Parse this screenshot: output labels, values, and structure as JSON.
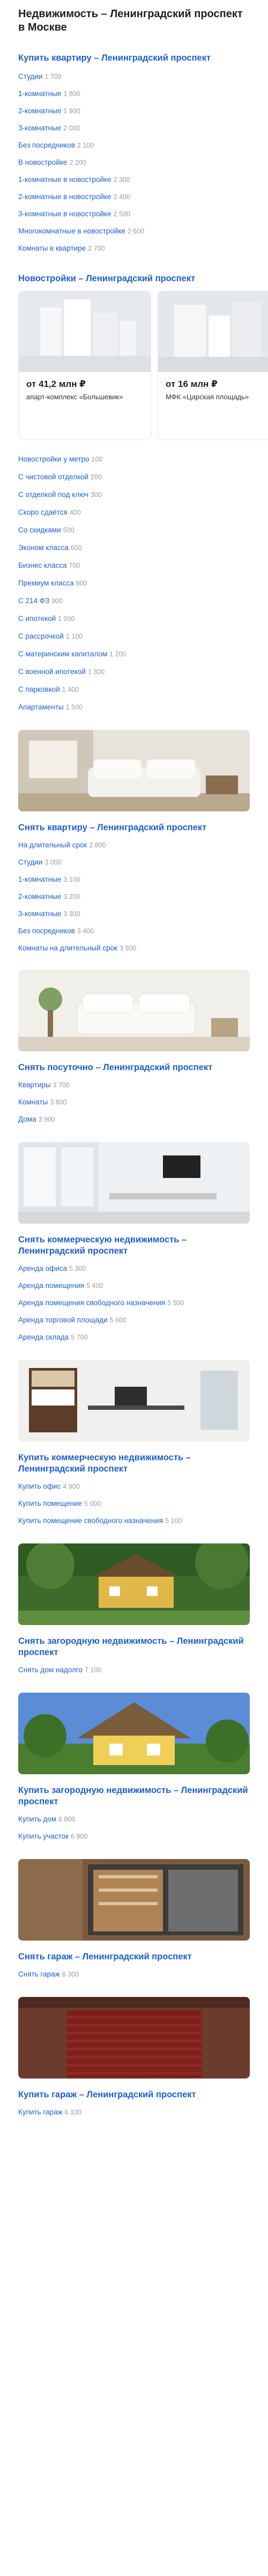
{
  "page": {
    "title": "Недвижимость – Ленинградский проспект в Москве"
  },
  "sections": {
    "buy_flat": {
      "title": "Купить квартиру – Ленинградский проспект",
      "links": [
        {
          "label": "Студии",
          "count": "1 700"
        },
        {
          "label": "1-комнатные",
          "count": "1 800"
        },
        {
          "label": "2-комнатные",
          "count": "1 900"
        },
        {
          "label": "3-комнатные",
          "count": "2 000"
        },
        {
          "label": "Без посредников",
          "count": "2 100"
        },
        {
          "label": "В новостройке",
          "count": "2 200"
        },
        {
          "label": "1-комнатные в новостройке",
          "count": "2 300"
        },
        {
          "label": "2-комнатные в новостройке",
          "count": "2 400"
        },
        {
          "label": "3-комнатные в новостройке",
          "count": "2 500"
        },
        {
          "label": "Многокомнатные в новостройке",
          "count": "2 600"
        },
        {
          "label": "Комнаты в квартире",
          "count": "2 700"
        }
      ]
    },
    "newbuildings": {
      "title": "Новостройки – Ленинградский проспект",
      "cards": [
        {
          "price": "от 41,2 млн ₽",
          "name": "апарт-комплекс «Большевик»"
        },
        {
          "price": "от 16 млн ₽",
          "name": "МФК «Царская площадь»"
        }
      ],
      "links": [
        {
          "label": "Новостройки у метро",
          "count": "100"
        },
        {
          "label": "С чистовой отделкой",
          "count": "200"
        },
        {
          "label": "С отделкой под ключ",
          "count": "300"
        },
        {
          "label": "Скоро сдаётся",
          "count": "400"
        },
        {
          "label": "Со скидками",
          "count": "500"
        },
        {
          "label": "Эконом класса",
          "count": "600"
        },
        {
          "label": "Бизнес класса",
          "count": "700"
        },
        {
          "label": "Премиум класса",
          "count": "800"
        },
        {
          "label": "С 214 ФЗ",
          "count": "900"
        },
        {
          "label": "С ипотекой",
          "count": "1 000"
        },
        {
          "label": "С рассрочкой",
          "count": "1 100"
        },
        {
          "label": "С материнским капиталом",
          "count": "1 200"
        },
        {
          "label": "С военной ипотекой",
          "count": "1 300"
        },
        {
          "label": "С парковкой",
          "count": "1 400"
        },
        {
          "label": "Апартаменты",
          "count": "1 500"
        }
      ]
    },
    "rent_flat": {
      "title": "Снять квартиру – Ленинградский проспект",
      "links": [
        {
          "label": "На длительный срок",
          "count": "2 800"
        },
        {
          "label": "Студии",
          "count": "3 000"
        },
        {
          "label": "1-комнатные",
          "count": "3 100"
        },
        {
          "label": "2-комнатные",
          "count": "3 200"
        },
        {
          "label": "3-комнатные",
          "count": "3 300"
        },
        {
          "label": "Без посредников",
          "count": "3 400"
        },
        {
          "label": "Комнаты на длительный срок",
          "count": "3 500"
        }
      ]
    },
    "daily": {
      "title": "Снять посуточно – Ленинградский проспект",
      "links": [
        {
          "label": "Квартиры",
          "count": "3 700"
        },
        {
          "label": "Комнаты",
          "count": "3 800"
        },
        {
          "label": "Дома",
          "count": "3 900"
        }
      ]
    },
    "rent_commercial": {
      "title": "Снять коммерческую недвижимость – Ленинградский проспект",
      "links": [
        {
          "label": "Аренда офиса",
          "count": "5 300"
        },
        {
          "label": "Аренда помещения",
          "count": "5 400"
        },
        {
          "label": "Аренда помещения свободного назначения",
          "count": "5 500"
        },
        {
          "label": "Аренда торговой площади",
          "count": "5 600"
        },
        {
          "label": "Аренда склада",
          "count": "5 700"
        }
      ]
    },
    "buy_commercial": {
      "title": "Купить коммерческую недвижимость – Ленинградский проспект",
      "links": [
        {
          "label": "Купить офис",
          "count": "4 900"
        },
        {
          "label": "Купить помещение",
          "count": "5 000"
        },
        {
          "label": "Купить помещение свободного назначения",
          "count": "5 100"
        }
      ]
    },
    "rent_country": {
      "title": "Снять загородную недвижимость – Ленинградский проспект",
      "links": [
        {
          "label": "Снять дом надолго",
          "count": "7 100"
        }
      ]
    },
    "buy_country": {
      "title": "Купить загородную недвижимость – Ленинградский проспект",
      "links": [
        {
          "label": "Купить дом",
          "count": "6 800"
        },
        {
          "label": "Купить участок",
          "count": "6 900"
        }
      ]
    },
    "rent_garage": {
      "title": "Снять гараж – Ленинградский проспект",
      "links": [
        {
          "label": "Снять гараж",
          "count": "6 300"
        }
      ]
    },
    "buy_garage": {
      "title": "Купить гараж – Ленинградский проспект",
      "links": [
        {
          "label": "Купить гараж",
          "count": "6 100"
        }
      ]
    }
  },
  "colors": {
    "link": "#1e5fcf",
    "count": "#9a9a9a",
    "title": "#1f1f1f"
  }
}
